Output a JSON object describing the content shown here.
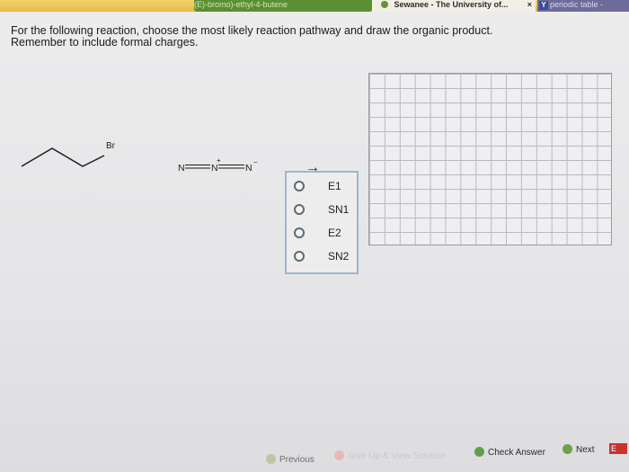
{
  "browser": {
    "tabs": [
      {
        "label": "(E)-bromo)-ethyl-4-butene"
      },
      {
        "label": "Sewanee - The University of..."
      },
      {
        "label": "periodic table - "
      }
    ],
    "tab_close_glyph": "×",
    "tab3_icon": "Y"
  },
  "question": {
    "line1": "For the following reaction, choose the most likely reaction pathway and draw the organic product.",
    "line2": "Remember to include formal charges."
  },
  "reactants": {
    "alkyl_halide_label": "Br",
    "azide": {
      "n1": "N",
      "n2": "N",
      "n3": "N",
      "plus": "+",
      "minus": "−"
    },
    "arrow": "→"
  },
  "choices": [
    {
      "label": "E1"
    },
    {
      "label": "SN1"
    },
    {
      "label": "E2"
    },
    {
      "label": "SN2"
    }
  ],
  "nav": {
    "previous": "Previous",
    "give_up": "Give Up & View Solution",
    "check_answer": "Check Answer",
    "next": "Next",
    "help": "E"
  }
}
